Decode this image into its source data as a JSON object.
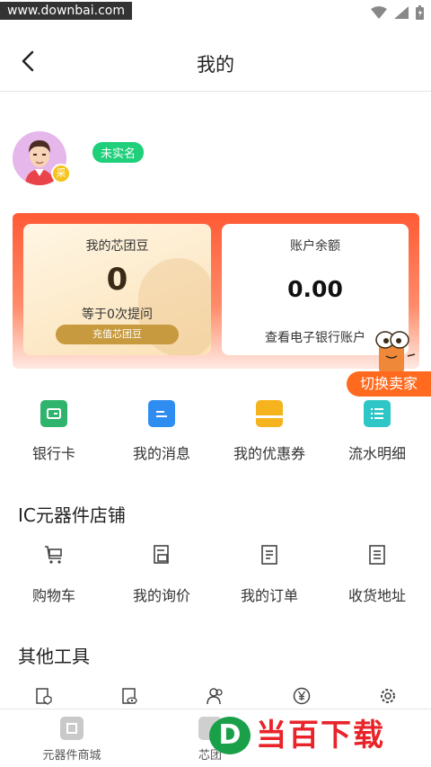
{
  "statusbar": {
    "watermark": "www.downbai.com"
  },
  "header": {
    "title": "我的"
  },
  "profile": {
    "badge": "采",
    "realname_status": "未实名"
  },
  "bean_card": {
    "title": "我的芯团豆",
    "value": "0",
    "subtitle": "等于0次提问",
    "button": "充值芯团豆"
  },
  "balance_card": {
    "title": "账户余额",
    "value": "0.00",
    "link": "查看电子银行账户"
  },
  "switch_button": "切换卖家",
  "quick_actions": [
    {
      "label": "银行卡",
      "icon": "bank-card-icon",
      "color": "#2fb36d"
    },
    {
      "label": "我的消息",
      "icon": "message-icon",
      "color": "#2f8cf0"
    },
    {
      "label": "我的优惠券",
      "icon": "coupon-icon",
      "color": "#f5b31e"
    },
    {
      "label": "流水明细",
      "icon": "ledger-icon",
      "color": "#2ec6c6"
    }
  ],
  "store": {
    "title": "IC元器件店铺",
    "items": [
      {
        "label": "购物车",
        "icon": "cart-icon"
      },
      {
        "label": "我的询价",
        "icon": "inquiry-icon"
      },
      {
        "label": "我的订单",
        "icon": "order-icon"
      },
      {
        "label": "收货地址",
        "icon": "address-icon"
      }
    ]
  },
  "tools": {
    "title": "其他工具",
    "items": [
      {
        "icon": "shield-doc-icon"
      },
      {
        "icon": "eye-doc-icon"
      },
      {
        "icon": "people-icon"
      },
      {
        "icon": "yen-icon"
      },
      {
        "icon": "settings-icon"
      }
    ]
  },
  "tabbar": {
    "tabs": [
      {
        "label": "元器件商城",
        "icon": "chip-icon"
      },
      {
        "label": "芯团",
        "icon": "group-icon"
      }
    ]
  },
  "overlay_logo": {
    "letter": "D",
    "text": "当百下载"
  }
}
